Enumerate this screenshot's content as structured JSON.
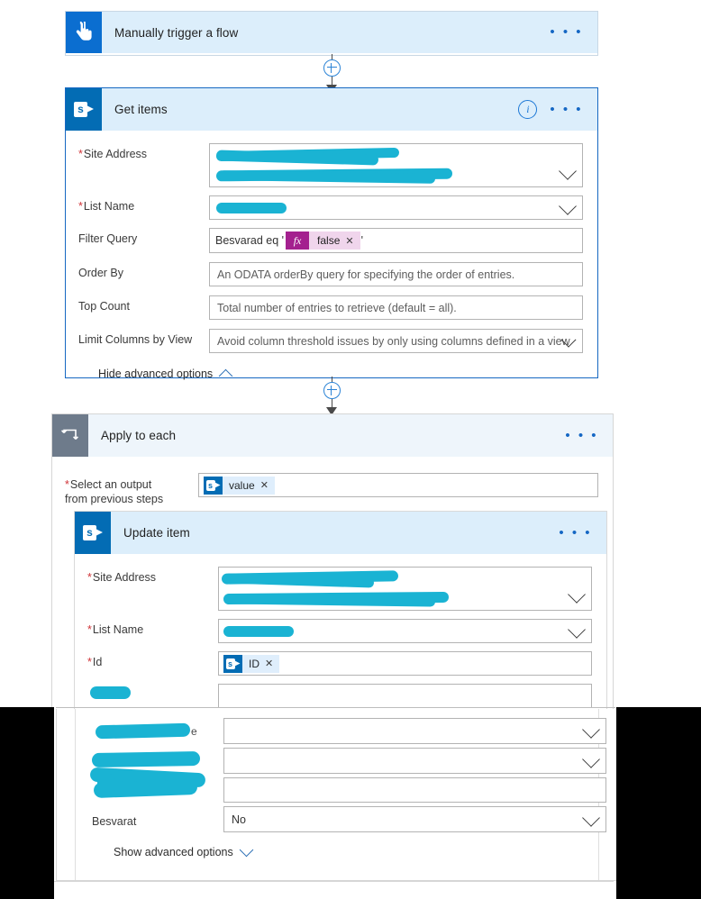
{
  "flow": {
    "trigger": {
      "title": "Manually trigger a flow",
      "icon": "tap-hand-icon",
      "menu": "• • •"
    },
    "get_items": {
      "title": "Get items",
      "icon": "sharepoint-icon",
      "info": "i",
      "menu": "• • •",
      "fields": [
        {
          "label": "Site Address",
          "required": true,
          "type": "dropdown",
          "value": "",
          "redacted": true
        },
        {
          "label": "List Name",
          "required": true,
          "type": "dropdown",
          "value": "",
          "redacted": true
        },
        {
          "label": "Filter Query",
          "required": false,
          "type": "token",
          "prefix": "Besvarad eq '",
          "token": "false",
          "suffix": "'"
        },
        {
          "label": "Order By",
          "required": false,
          "type": "text",
          "placeholder": "An ODATA orderBy query for specifying the order of entries."
        },
        {
          "label": "Top Count",
          "required": false,
          "type": "text",
          "placeholder": "Total number of entries to retrieve (default = all)."
        },
        {
          "label": "Limit Columns by View",
          "required": false,
          "type": "dropdown",
          "placeholder": "Avoid column threshold issues by only using columns defined in a view"
        }
      ],
      "advanced_toggle": "Hide advanced options"
    },
    "apply_to_each": {
      "title": "Apply to each",
      "icon": "loop-repeat-icon",
      "menu": "• • •",
      "output_label_line1": "Select an output",
      "output_label_line2": "from previous steps",
      "output_required": true,
      "output_token": "value"
    },
    "update_item": {
      "title": "Update item",
      "icon": "sharepoint-icon",
      "menu": "• • •",
      "fields": [
        {
          "label": "Site Address",
          "required": true,
          "type": "dropdown",
          "value": "",
          "redacted": true
        },
        {
          "label": "List Name",
          "required": true,
          "type": "dropdown",
          "value": "",
          "redacted": true
        },
        {
          "label": "Id",
          "required": true,
          "type": "token",
          "token": "ID"
        },
        {
          "label": "",
          "required": false,
          "type": "text",
          "value": "",
          "redacted": true
        },
        {
          "label": "",
          "required": false,
          "type": "text",
          "value": "",
          "redacted": true
        }
      ],
      "lower_fields": [
        {
          "label": "",
          "type": "dropdown",
          "value": "",
          "redacted": true
        },
        {
          "label": "",
          "type": "dropdown",
          "value": "",
          "redacted": true
        },
        {
          "label": "",
          "type": "text",
          "value": "",
          "redacted": true
        },
        {
          "label": "Besvarat",
          "type": "dropdown",
          "value": "No",
          "redacted": false
        }
      ],
      "advanced_toggle": "Show advanced options"
    }
  },
  "colors": {
    "accent_blue": "#0b6ed0",
    "sharepoint_blue": "#036cb4",
    "card_header": "#dceefb",
    "loop_gray": "#6e7b8b",
    "redaction_cyan": "#1ab3d3",
    "token_pink": "#a4218f",
    "required_red": "#d03438"
  }
}
